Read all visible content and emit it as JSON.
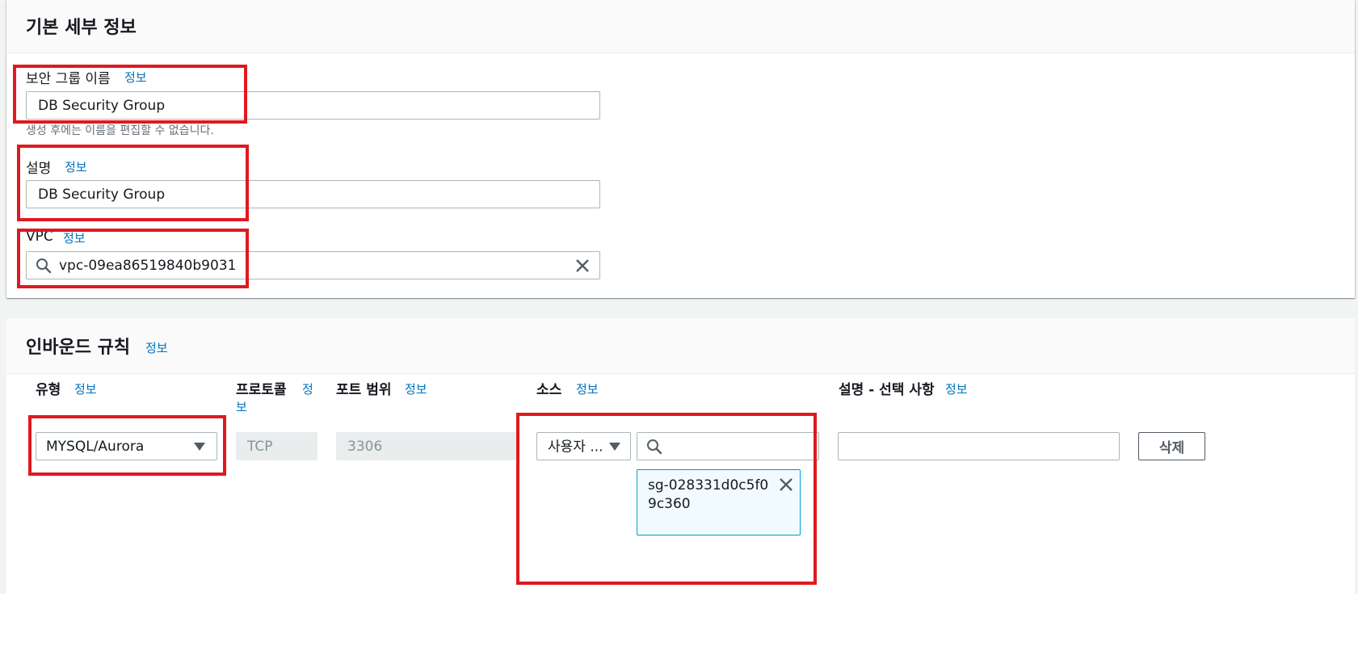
{
  "basic": {
    "title": "기본 세부 정보",
    "name_label": "보안 그룹 이름",
    "name_info": "정보",
    "name_value": "DB Security Group",
    "name_hint": "생성 후에는 이름을 편집할 수 없습니다.",
    "desc_label": "설명",
    "desc_info": "정보",
    "desc_value": "DB Security Group",
    "vpc_label": "VPC",
    "vpc_info": "정보",
    "vpc_value": "vpc-09ea86519840b9031"
  },
  "inbound": {
    "title": "인바운드 규칙",
    "title_info": "정보",
    "columns": {
      "type": "유형",
      "type_info": "정보",
      "protocol": "프로토콜",
      "protocol_info_line1": "정",
      "protocol_info_line2": "보",
      "port": "포트 범위",
      "port_info": "정보",
      "source": "소스",
      "source_info": "정보",
      "description": "설명 - 선택 사항",
      "description_info": "정보"
    },
    "rule": {
      "type_value": "MYSQL/Aurora",
      "protocol_value": "TCP",
      "port_value": "3306",
      "source_mode": "사용자 ...",
      "source_search": "",
      "source_token": "sg-028331d0c5f09c360",
      "description_value": "",
      "delete_label": "삭제"
    }
  },
  "colors": {
    "highlight": "#e0191f",
    "link": "#0073bb",
    "token_border": "#00a1c9"
  }
}
